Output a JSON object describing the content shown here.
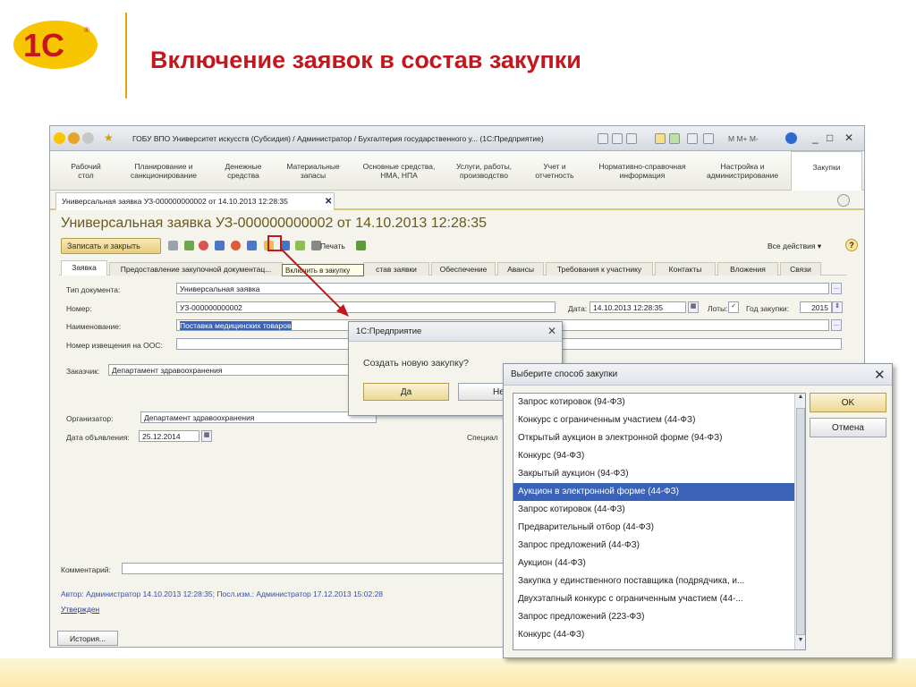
{
  "slide": {
    "title": "Включение заявок в состав закупки"
  },
  "app": {
    "window_title": "ГОБУ ВПО Университет искусств (Субсидия) / Администратор / Бухгалтерия государственного у... (1С:Предприятие)",
    "mem_buttons": "M  M+  M-",
    "sections": [
      {
        "label": "Рабочий стол"
      },
      {
        "label": "Планирование и санкционирование"
      },
      {
        "label": "Денежные средства"
      },
      {
        "label": "Материальные запасы"
      },
      {
        "label": "Основные средства, НМА, НПА"
      },
      {
        "label": "Услуги, работы, производство"
      },
      {
        "label": "Учет и отчетность"
      },
      {
        "label": "Нормативно-справочная информация"
      },
      {
        "label": "Настройка и администрирование"
      },
      {
        "label": "Закупки"
      }
    ],
    "doc_tab": "Универсальная заявка УЗ-000000000002 от 14.10.2013 12:28:35",
    "doc_heading": "Универсальная заявка УЗ-000000000002 от 14.10.2013 12:28:35",
    "toolbar": {
      "save_close": "Записать и закрыть",
      "print": "Печать",
      "all_actions": "Все действия ▾",
      "help": "?"
    },
    "tooltip": "Включить в закупку",
    "inner_tabs": [
      "Заявка",
      "Предоставление закупочной документац...",
      "став заявки",
      "Обеспечение",
      "Авансы",
      "Требования к участнику",
      "Контакты",
      "Вложения",
      "Связи"
    ],
    "form": {
      "doc_type_label": "Тип документа:",
      "doc_type": "Универсальная заявка",
      "number_label": "Номер:",
      "number": "УЗ-000000000002",
      "date_label": "Дата:",
      "date": "14.10.2013 12:28:35",
      "lots_label": "Лоты:",
      "year_label": "Год закупки:",
      "year": "2015",
      "name_label": "Наименование:",
      "name": "Поставка медицинских товаров",
      "notice_label": "Номер извещения на ООС:",
      "customer_label": "Заказчик:",
      "customer": "Департамент здравоохранения",
      "organizer_label": "Организатор:",
      "organizer": "Департамент здравоохранения",
      "announce_label": "Дата объявления:",
      "announce_date": "25.12.2014",
      "special_label": "Специал",
      "comment_label": "Комментарий:",
      "author_line": "Автор: Администратор 14.10.2013 12:28:35; Посл.изм.: Администратор 17.12.2013 15:02:28",
      "approved": "Утвержден",
      "history": "История..."
    }
  },
  "confirm_dialog": {
    "title": "1С:Предприятие",
    "question": "Создать новую закупку?",
    "yes": "Да",
    "no": "Нет"
  },
  "select_dialog": {
    "title": "Выберите способ закупки",
    "ok": "OK",
    "cancel": "Отмена",
    "selected_index": 5,
    "methods": [
      "Запрос котировок (94-ФЗ)",
      "Конкурс с ограниченным участием (44-ФЗ)",
      "Открытый аукцион в электронной форме (94-ФЗ)",
      "Конкурс (94-ФЗ)",
      "Закрытый аукцион (94-ФЗ)",
      "Аукцион в электронной форме (44-ФЗ)",
      "Запрос котировок (44-ФЗ)",
      "Предварительный отбор (44-ФЗ)",
      "Запрос предложений (44-ФЗ)",
      "Аукцион (44-ФЗ)",
      "Закупка у единственного поставщика (подрядчика, и...",
      "Двухэтапный конкурс с ограниченным участием (44-...",
      "Запрос предложений (223-ФЗ)",
      "Конкурс (44-ФЗ)"
    ]
  },
  "colors": {
    "title_red": "#c4161c",
    "logo_yellow": "#f7c600",
    "selection_blue": "#3a63b8"
  }
}
